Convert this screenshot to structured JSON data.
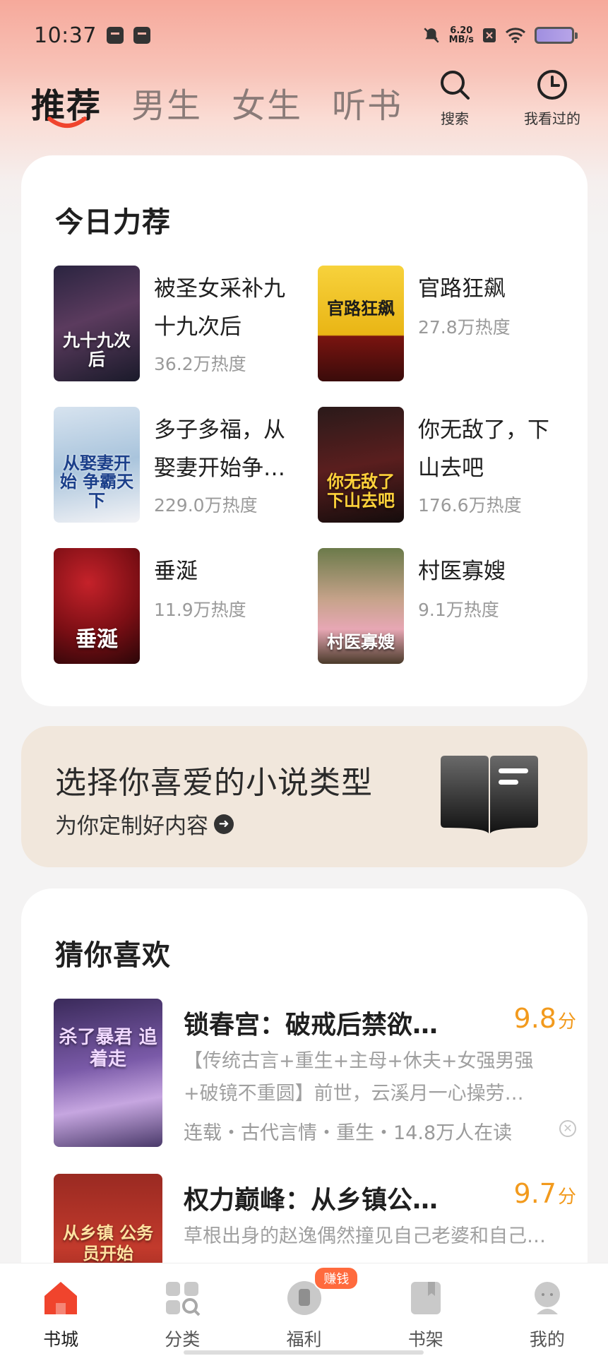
{
  "status_bar": {
    "time": "10:37",
    "net_speed_value": "6.20",
    "net_speed_unit": "MB/s"
  },
  "header": {
    "tabs": [
      {
        "label": "推荐",
        "active": true
      },
      {
        "label": "男生",
        "active": false
      },
      {
        "label": "女生",
        "active": false
      },
      {
        "label": "听书",
        "active": false
      }
    ],
    "search_label": "搜索",
    "history_label": "我看过的"
  },
  "recommend": {
    "title": "今日力荐",
    "items": [
      {
        "title": "被圣女采补九十九次后",
        "heat": "36.2万热度",
        "cover_text": "九十九次后"
      },
      {
        "title": "官路狂飙",
        "heat": "27.8万热度",
        "cover_text": "官路狂飙"
      },
      {
        "title": "多子多福，从娶妻开始争霸天下",
        "heat": "229.0万热度",
        "cover_text": "从娶妻开始 争霸天下"
      },
      {
        "title": "你无敌了，下山去吧",
        "heat": "176.6万热度",
        "cover_text": "你无敌了 下山去吧"
      },
      {
        "title": "垂涎",
        "heat": "11.9万热度",
        "cover_text": "垂涎"
      },
      {
        "title": "村医寡嫂",
        "heat": "9.1万热度",
        "cover_text": "村医寡嫂"
      }
    ]
  },
  "banner": {
    "title": "选择你喜爱的小说类型",
    "subtitle": "为你定制好内容",
    "arrow_icon": "arrow-right-icon"
  },
  "guess": {
    "title": "猜你喜欢",
    "items": [
      {
        "title": "锁春宫：破戒后禁欲…",
        "score": "9.8",
        "score_unit": "分",
        "description": "【传统古言+重生+主母+休夫+女强男强+破镜不重圆】前世，云溪月一心操劳…",
        "meta": "连载・古代言情・重生・14.8万人在读",
        "cover_text": "杀了暴君 追着走"
      },
      {
        "title": "权力巅峰：从乡镇公…",
        "score": "9.7",
        "score_unit": "分",
        "description": "草根出身的赵逸偶然撞见自己老婆和自己…",
        "meta": "",
        "cover_text": "从乡镇 公务员开始"
      }
    ]
  },
  "bottom_nav": {
    "items": [
      {
        "label": "书城",
        "icon": "home-icon",
        "active": true
      },
      {
        "label": "分类",
        "icon": "category-icon",
        "active": false
      },
      {
        "label": "福利",
        "icon": "gift-icon",
        "active": false,
        "badge": "赚钱"
      },
      {
        "label": "书架",
        "icon": "bookshelf-icon",
        "active": false
      },
      {
        "label": "我的",
        "icon": "profile-icon",
        "active": false
      }
    ]
  },
  "colors": {
    "accent": "#f0442d",
    "score": "#f29a1d",
    "banner_bg": "#f1e7dc"
  }
}
